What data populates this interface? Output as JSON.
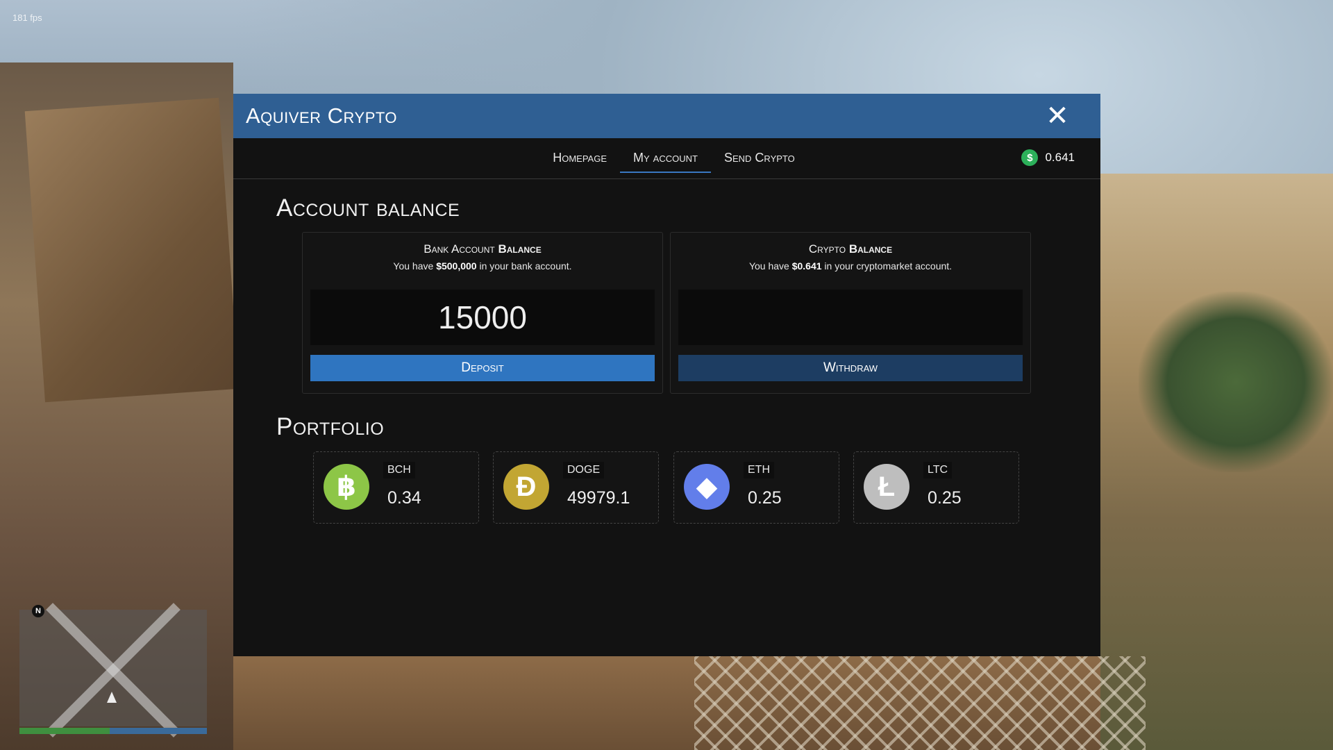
{
  "hud": {
    "fps": "181 fps",
    "north_label": "N"
  },
  "app": {
    "title": "Aquiver Crypto"
  },
  "nav": {
    "tabs": [
      {
        "label": "Homepage"
      },
      {
        "label": "My account"
      },
      {
        "label": "Send Crypto"
      }
    ],
    "active_tab": "My account",
    "wallet_balance": "0.641",
    "wallet_icon": "$"
  },
  "account_balance": {
    "heading": "Account balance",
    "bank": {
      "title_prefix": "Bank Account ",
      "title_bold": "Balance",
      "sub_prefix": "You have ",
      "sub_amount": "$500,000",
      "sub_suffix": " in your bank account.",
      "input_value": "15000",
      "button_label": "Deposit"
    },
    "crypto": {
      "title_prefix": "Crypto ",
      "title_bold": "Balance",
      "sub_prefix": "You have ",
      "sub_amount": "$0.641",
      "sub_suffix": " in your cryptomarket account.",
      "input_value": "",
      "button_label": "Withdraw"
    }
  },
  "portfolio": {
    "heading": "Portfolio",
    "coins": [
      {
        "ticker": "BCH",
        "amount": "0.34",
        "icon": "bitcoin-cash-icon",
        "glyph": "฿",
        "color": "#8dc647"
      },
      {
        "ticker": "DOGE",
        "amount": "49979.1",
        "icon": "dogecoin-icon",
        "glyph": "Ð",
        "color": "#c2a633"
      },
      {
        "ticker": "ETH",
        "amount": "0.25",
        "icon": "ethereum-icon",
        "glyph": "◆",
        "color": "#627eea"
      },
      {
        "ticker": "LTC",
        "amount": "0.25",
        "icon": "litecoin-icon",
        "glyph": "Ł",
        "color": "#bebebe"
      }
    ]
  },
  "colors": {
    "title_bar": "#2f5f93",
    "deposit_button": "#2f75c0",
    "withdraw_button": "#1d3d62",
    "wallet_coin": "#2cb05a"
  }
}
